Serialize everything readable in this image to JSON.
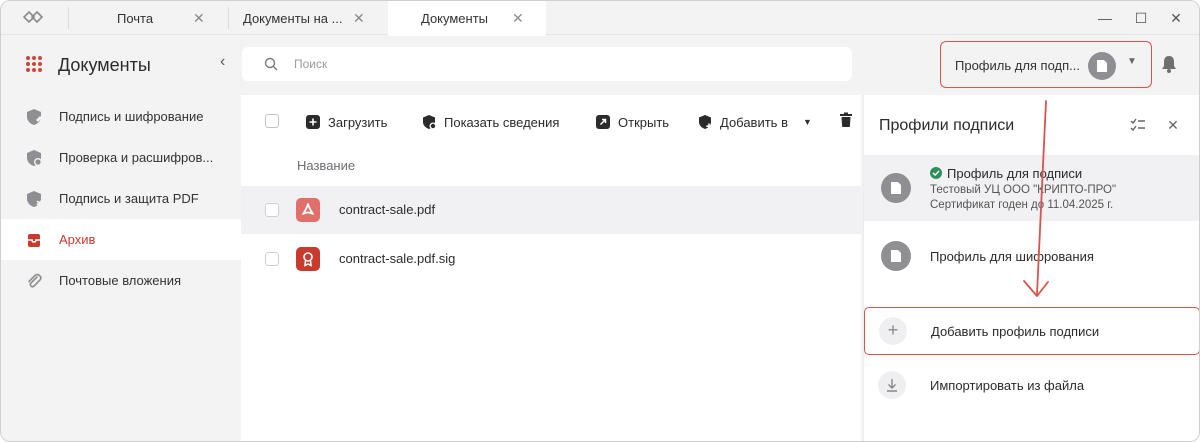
{
  "tabs": [
    {
      "label": "Почта",
      "active": false
    },
    {
      "label": "Документы на ...",
      "active": false
    },
    {
      "label": "Документы",
      "active": true
    }
  ],
  "window_controls": {
    "minimize": "—",
    "maximize": "☐",
    "close": "✕"
  },
  "sidebar": {
    "title": "Документы",
    "collapse_glyph": "‹",
    "items": [
      {
        "label": "Подпись и шифрование",
        "icon": "shield-pen-icon",
        "active": false
      },
      {
        "label": "Проверка и расшифров...",
        "icon": "shield-check-icon",
        "active": false
      },
      {
        "label": "Подпись и защита PDF",
        "icon": "shield-pdf-icon",
        "active": false
      },
      {
        "label": "Архив",
        "icon": "archive-icon",
        "active": true
      },
      {
        "label": "Почтовые вложения",
        "icon": "paperclip-icon",
        "active": false
      }
    ]
  },
  "search": {
    "placeholder": "Поиск",
    "value": ""
  },
  "profile_selector": {
    "label": "Профиль для подп...",
    "icon": "document-icon"
  },
  "toolbar": {
    "upload_label": "Загрузить",
    "show_info_label": "Показать сведения",
    "open_label": "Открыть",
    "add_to_label": "Добавить в"
  },
  "file_list": {
    "column_name": "Название",
    "files": [
      {
        "name": "contract-sale.pdf",
        "icon": "pdf-icon",
        "color": "#e2706a",
        "selected": true
      },
      {
        "name": "contract-sale.pdf.sig",
        "icon": "signature-icon",
        "color": "#c8392e",
        "selected": false
      }
    ]
  },
  "profiles_panel": {
    "title": "Профили подписи",
    "profiles": [
      {
        "name": "Профиль для подписи",
        "line1": "Тестовый УЦ ООО \"КРИПТО-ПРО\"",
        "line2": "Сертификат годен до 11.04.2025 г.",
        "default": true,
        "selected": true
      },
      {
        "name": "Профиль для шифрования",
        "default": false,
        "selected": false
      }
    ],
    "add_label": "Добавить профиль подписи",
    "import_label": "Импортировать из файла"
  },
  "colors": {
    "accent": "#c8392e",
    "highlight_frame": "#d9534f",
    "success": "#2f8f5b",
    "avatar": "#8e8e93"
  }
}
